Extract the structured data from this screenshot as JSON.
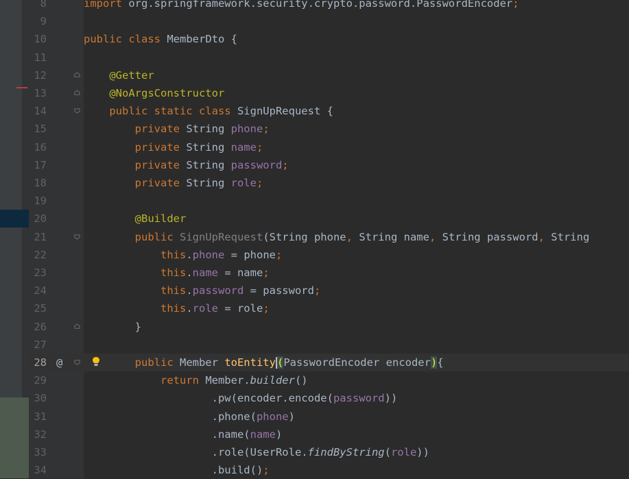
{
  "editor": {
    "lines": [
      {
        "num": "8",
        "tokens": [
          {
            "t": "import ",
            "c": "kw"
          },
          {
            "t": "org.springframework.security.crypto.password.PasswordEncoder",
            "c": "plain"
          },
          {
            "t": ";",
            "c": "kw"
          }
        ]
      },
      {
        "num": "9",
        "tokens": []
      },
      {
        "num": "10",
        "tokens": [
          {
            "t": "public class ",
            "c": "kw"
          },
          {
            "t": "MemberDto {",
            "c": "plain"
          }
        ]
      },
      {
        "num": "11",
        "tokens": []
      },
      {
        "num": "12",
        "tokens": [
          {
            "t": "    "
          },
          {
            "t": "@Getter",
            "c": "an"
          }
        ]
      },
      {
        "num": "13",
        "tokens": [
          {
            "t": "    "
          },
          {
            "t": "@NoArgsConstructor",
            "c": "an"
          }
        ]
      },
      {
        "num": "14",
        "tokens": [
          {
            "t": "    "
          },
          {
            "t": "public static class ",
            "c": "kw"
          },
          {
            "t": "SignUpRequest {",
            "c": "plain"
          }
        ]
      },
      {
        "num": "15",
        "tokens": [
          {
            "t": "        "
          },
          {
            "t": "private ",
            "c": "kw"
          },
          {
            "t": "String ",
            "c": "plain"
          },
          {
            "t": "phone",
            "c": "fd"
          },
          {
            "t": ";",
            "c": "kw"
          }
        ]
      },
      {
        "num": "16",
        "tokens": [
          {
            "t": "        "
          },
          {
            "t": "private ",
            "c": "kw"
          },
          {
            "t": "String ",
            "c": "plain"
          },
          {
            "t": "name",
            "c": "fd"
          },
          {
            "t": ";",
            "c": "kw"
          }
        ]
      },
      {
        "num": "17",
        "tokens": [
          {
            "t": "        "
          },
          {
            "t": "private ",
            "c": "kw"
          },
          {
            "t": "String ",
            "c": "plain"
          },
          {
            "t": "password",
            "c": "fd"
          },
          {
            "t": ";",
            "c": "kw"
          }
        ]
      },
      {
        "num": "18",
        "tokens": [
          {
            "t": "        "
          },
          {
            "t": "private ",
            "c": "kw"
          },
          {
            "t": "String ",
            "c": "plain"
          },
          {
            "t": "role",
            "c": "fd"
          },
          {
            "t": ";",
            "c": "kw"
          }
        ]
      },
      {
        "num": "19",
        "tokens": []
      },
      {
        "num": "20",
        "tokens": [
          {
            "t": "        "
          },
          {
            "t": "@Builder",
            "c": "an"
          }
        ]
      },
      {
        "num": "21",
        "tokens": [
          {
            "t": "        "
          },
          {
            "t": "public ",
            "c": "kw"
          },
          {
            "t": "SignUpRequest",
            "c": "gr"
          },
          {
            "t": "(String phone",
            "c": "plain"
          },
          {
            "t": ", ",
            "c": "kw"
          },
          {
            "t": "String name",
            "c": "plain"
          },
          {
            "t": ", ",
            "c": "kw"
          },
          {
            "t": "String password",
            "c": "plain"
          },
          {
            "t": ", ",
            "c": "kw"
          },
          {
            "t": "String",
            "c": "plain"
          }
        ]
      },
      {
        "num": "22",
        "tokens": [
          {
            "t": "            "
          },
          {
            "t": "this",
            "c": "kw"
          },
          {
            "t": ".",
            "c": "plain"
          },
          {
            "t": "phone",
            "c": "fd"
          },
          {
            "t": " = phone",
            "c": "plain"
          },
          {
            "t": ";",
            "c": "kw"
          }
        ]
      },
      {
        "num": "23",
        "tokens": [
          {
            "t": "            "
          },
          {
            "t": "this",
            "c": "kw"
          },
          {
            "t": ".",
            "c": "plain"
          },
          {
            "t": "name",
            "c": "fd"
          },
          {
            "t": " = name",
            "c": "plain"
          },
          {
            "t": ";",
            "c": "kw"
          }
        ]
      },
      {
        "num": "24",
        "tokens": [
          {
            "t": "            "
          },
          {
            "t": "this",
            "c": "kw"
          },
          {
            "t": ".",
            "c": "plain"
          },
          {
            "t": "password",
            "c": "fd"
          },
          {
            "t": " = password",
            "c": "plain"
          },
          {
            "t": ";",
            "c": "kw"
          }
        ]
      },
      {
        "num": "25",
        "tokens": [
          {
            "t": "            "
          },
          {
            "t": "this",
            "c": "kw"
          },
          {
            "t": ".",
            "c": "plain"
          },
          {
            "t": "role",
            "c": "fd"
          },
          {
            "t": " = role",
            "c": "plain"
          },
          {
            "t": ";",
            "c": "kw"
          }
        ]
      },
      {
        "num": "26",
        "tokens": [
          {
            "t": "        }",
            "c": "plain"
          }
        ]
      },
      {
        "num": "27",
        "tokens": []
      },
      {
        "num": "28",
        "current": true,
        "tokens": [
          {
            "t": "        "
          },
          {
            "t": "public ",
            "c": "kw"
          },
          {
            "t": "Member ",
            "c": "plain"
          },
          {
            "t": "toEntity",
            "c": "mt"
          },
          {
            "caret": true
          },
          {
            "t": "(",
            "c": "brace-hl"
          },
          {
            "t": "PasswordEncoder encoder",
            "c": "plain"
          },
          {
            "t": ")",
            "c": "brace-hl"
          },
          {
            "t": "{",
            "c": "plain"
          }
        ]
      },
      {
        "num": "29",
        "tokens": [
          {
            "t": "            "
          },
          {
            "t": "return ",
            "c": "kw"
          },
          {
            "t": "Member.",
            "c": "plain"
          },
          {
            "t": "builder",
            "c": "plain it"
          },
          {
            "t": "()",
            "c": "plain"
          }
        ]
      },
      {
        "num": "30",
        "tokens": [
          {
            "t": "                    .pw(encoder.encode(",
            "c": "plain"
          },
          {
            "t": "password",
            "c": "fd"
          },
          {
            "t": "))",
            "c": "plain"
          }
        ]
      },
      {
        "num": "31",
        "tokens": [
          {
            "t": "                    .phone(",
            "c": "plain"
          },
          {
            "t": "phone",
            "c": "fd"
          },
          {
            "t": ")",
            "c": "plain"
          }
        ]
      },
      {
        "num": "32",
        "tokens": [
          {
            "t": "                    .name(",
            "c": "plain"
          },
          {
            "t": "name",
            "c": "fd"
          },
          {
            "t": ")",
            "c": "plain"
          }
        ]
      },
      {
        "num": "33",
        "tokens": [
          {
            "t": "                    .role(UserRole.",
            "c": "plain"
          },
          {
            "t": "findByString",
            "c": "plain it"
          },
          {
            "t": "(",
            "c": "plain"
          },
          {
            "t": "role",
            "c": "fd"
          },
          {
            "t": "))",
            "c": "plain"
          }
        ]
      },
      {
        "num": "34",
        "tokens": [
          {
            "t": "                    .build()",
            "c": "plain"
          },
          {
            "t": ";",
            "c": "kw"
          }
        ]
      }
    ],
    "gutter_marks": {
      "override_marker": "@",
      "intention_icon": "lightbulb-icon",
      "fold_icon": "fold-marker-icon"
    },
    "colors": {
      "background": "#2b2b2b",
      "keyword": "#cc7832",
      "annotation": "#bbb529",
      "field": "#9876aa",
      "method_decl": "#ffc66d",
      "plain": "#a9b7c6",
      "line_number": "#606366"
    }
  }
}
